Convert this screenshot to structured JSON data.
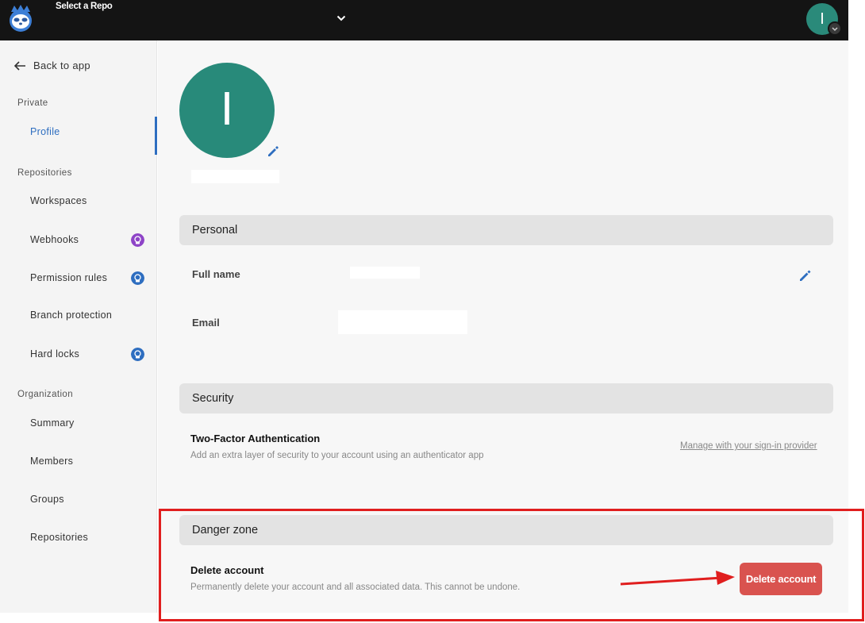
{
  "topbar": {
    "repo_title": "Select a Repo",
    "avatar_letter": "I",
    "icons": {
      "logo": "sloth-logo-icon",
      "chevron": "chevron-down-icon"
    },
    "avatar_color": "#2a8a7a"
  },
  "sidebar": {
    "back_label": "Back to app",
    "sections": {
      "private": "Private",
      "repositories": "Repositories",
      "organization": "Organization"
    },
    "items": {
      "profile": "Profile",
      "workspaces": "Workspaces",
      "webhooks": "Webhooks",
      "permission_rules": "Permission rules",
      "branch_protection": "Branch protection",
      "hard_locks": "Hard locks",
      "summary": "Summary",
      "members": "Members",
      "groups": "Groups",
      "repositories": "Repositories"
    },
    "active_item": "Profile",
    "badge_colors": {
      "webhooks": "#8e44c7",
      "permission_rules": "#2e6ec0",
      "hard_locks": "#2e6ec0"
    }
  },
  "profile": {
    "avatar_letter": "I",
    "avatar_color": "#288a7a"
  },
  "personal": {
    "heading": "Personal",
    "full_name_label": "Full name",
    "email_label": "Email"
  },
  "security": {
    "heading": "Security",
    "two_factor_title": "Two-Factor Authentication",
    "two_factor_desc": "Add an extra layer of security to your account using an authenticator app",
    "manage_link": "Manage with your sign-in provider"
  },
  "danger": {
    "heading": "Danger zone",
    "delete_title": "Delete account",
    "delete_desc": "Permanently delete your account and all associated data. This cannot be undone.",
    "delete_button": "Delete account",
    "button_color": "#d9534f",
    "highlight_color": "#e01e1e"
  }
}
